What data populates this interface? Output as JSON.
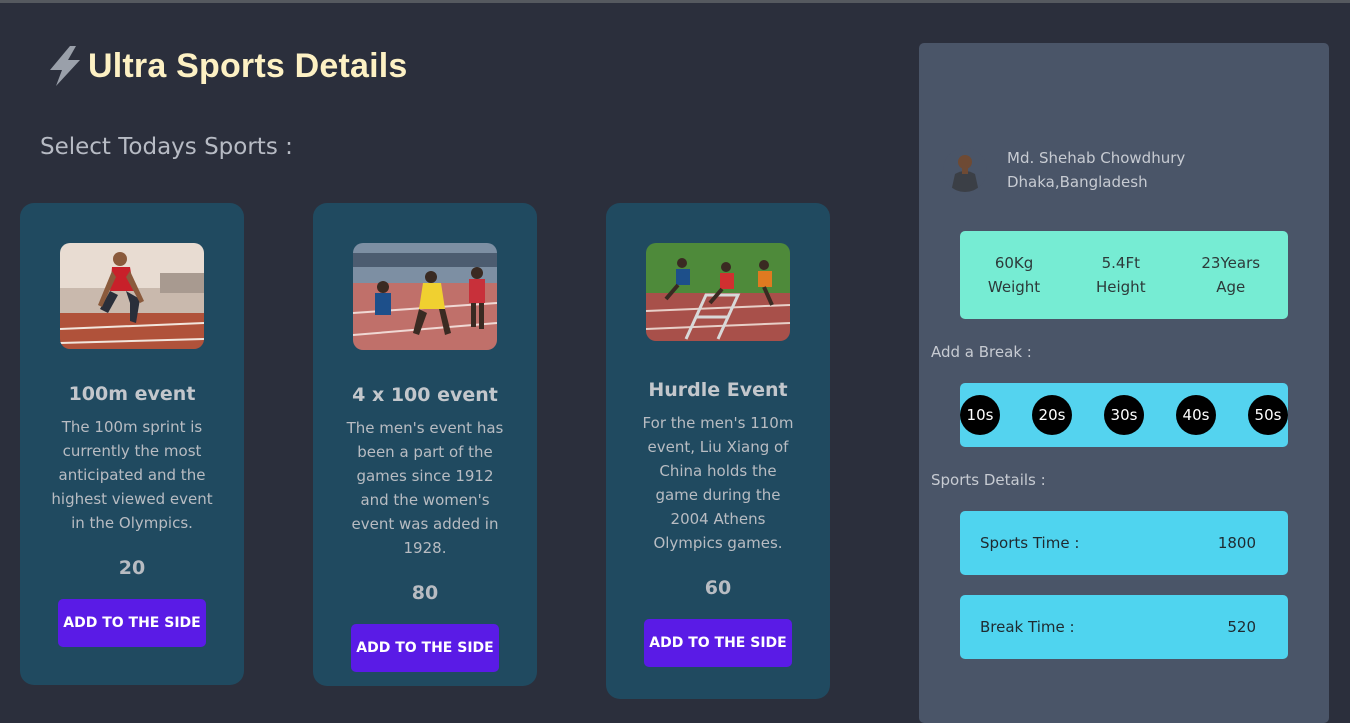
{
  "header": {
    "title": "Ultra Sports Details",
    "subtitle": "Select Todays Sports :"
  },
  "cards": [
    {
      "name": "100m event",
      "description": "The 100m sprint is currently the most anticipated and the highest viewed event in the Olympics.",
      "time": "20",
      "button": "ADD TO THE SIDE",
      "image": "sprinter-start-photo"
    },
    {
      "name": "4 x 100 event",
      "description": "The men's event has been a part of the games since 1912 and the women's event was added in 1928.",
      "time": "80",
      "button": "ADD TO THE SIDE",
      "image": "relay-race-photo"
    },
    {
      "name": "Hurdle Event",
      "description": "For the men's 110m event, Liu Xiang of China holds the game during the 2004 Athens Olympics games.",
      "time": "60",
      "button": "ADD TO THE SIDE",
      "image": "hurdle-race-photo"
    }
  ],
  "profile": {
    "name": "Md. Shehab Chowdhury",
    "location": "Dhaka,Bangladesh",
    "stats": [
      {
        "value": "60Kg",
        "label": "Weight"
      },
      {
        "value": "5.4Ft",
        "label": "Height"
      },
      {
        "value": "23Years",
        "label": "Age"
      }
    ]
  },
  "breaks": {
    "label": "Add a Break :",
    "options": [
      "10s",
      "20s",
      "30s",
      "40s",
      "50s"
    ]
  },
  "details": {
    "label": "Sports Details :",
    "sports_time_label": "Sports Time :",
    "sports_time": "1800",
    "break_time_label": "Break Time :",
    "break_time": "520"
  },
  "colors": {
    "background": "#2b2f3c",
    "card": "#204a60",
    "button": "#5a1be6",
    "sidebar": "#4a5568",
    "stats": "#76ecd3",
    "breaks": "#54d3ef",
    "title": "#fdf1c4"
  }
}
